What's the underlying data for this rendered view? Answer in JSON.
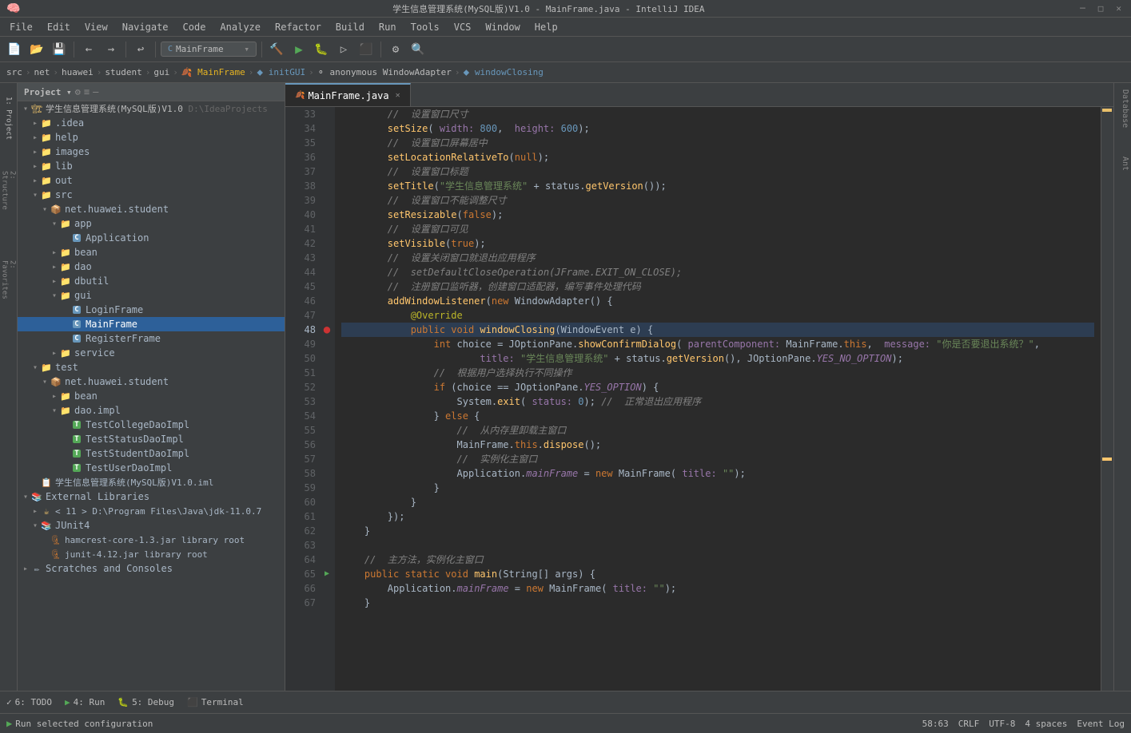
{
  "titleBar": {
    "title": "学生信息管理系统(MySQL版)V1.0 - MainFrame.java - IntelliJ IDEA",
    "controls": [
      "minimize",
      "maximize",
      "close"
    ]
  },
  "menuBar": {
    "items": [
      "File",
      "Edit",
      "View",
      "Navigate",
      "Code",
      "Analyze",
      "Refactor",
      "Build",
      "Run",
      "Tools",
      "VCS",
      "Window",
      "Help"
    ]
  },
  "toolbar": {
    "configName": "MainFrame",
    "buttons": [
      "back",
      "forward",
      "undo",
      "redo",
      "build",
      "run",
      "debug",
      "run-coverage",
      "stop",
      "settings",
      "search"
    ]
  },
  "breadcrumb": {
    "items": [
      {
        "label": "src",
        "type": "folder"
      },
      {
        "label": "net",
        "type": "folder"
      },
      {
        "label": "huawei",
        "type": "folder"
      },
      {
        "label": "student",
        "type": "folder"
      },
      {
        "label": "gui",
        "type": "folder"
      },
      {
        "label": "MainFrame",
        "type": "java"
      },
      {
        "label": "initGUI",
        "type": "method"
      },
      {
        "label": "anonymous WindowAdapter",
        "type": "anonymous"
      },
      {
        "label": "windowClosing",
        "type": "method"
      }
    ]
  },
  "projectPanel": {
    "title": "Project",
    "rootItems": [
      {
        "label": "学生信息管理系统(MySQL版)V1.0",
        "suffix": "D:\\IdeaProjects",
        "type": "project",
        "expanded": true,
        "children": [
          {
            "label": ".idea",
            "type": "folder",
            "expanded": false
          },
          {
            "label": "help",
            "type": "folder",
            "expanded": false
          },
          {
            "label": "images",
            "type": "folder",
            "expanded": false
          },
          {
            "label": "lib",
            "type": "folder",
            "expanded": false
          },
          {
            "label": "out",
            "type": "folder",
            "expanded": false
          },
          {
            "label": "src",
            "type": "folder",
            "expanded": true,
            "children": [
              {
                "label": "net.huawei.student",
                "type": "package",
                "expanded": true,
                "children": [
                  {
                    "label": "app",
                    "type": "folder",
                    "expanded": true,
                    "children": [
                      {
                        "label": "Application",
                        "type": "class",
                        "expanded": false
                      }
                    ]
                  },
                  {
                    "label": "bean",
                    "type": "folder",
                    "expanded": false
                  },
                  {
                    "label": "dao",
                    "type": "folder",
                    "expanded": false
                  },
                  {
                    "label": "dbutil",
                    "type": "folder",
                    "expanded": false
                  },
                  {
                    "label": "gui",
                    "type": "folder",
                    "expanded": true,
                    "children": [
                      {
                        "label": "LoginFrame",
                        "type": "class"
                      },
                      {
                        "label": "MainFrame",
                        "type": "class",
                        "selected": true
                      },
                      {
                        "label": "RegisterFrame",
                        "type": "class"
                      }
                    ]
                  },
                  {
                    "label": "service",
                    "type": "folder",
                    "expanded": false
                  }
                ]
              }
            ]
          },
          {
            "label": "test",
            "type": "folder",
            "expanded": true,
            "children": [
              {
                "label": "net.huawei.student",
                "type": "package",
                "expanded": true,
                "children": [
                  {
                    "label": "bean",
                    "type": "folder",
                    "expanded": false
                  },
                  {
                    "label": "dao.impl",
                    "type": "folder",
                    "expanded": true,
                    "children": [
                      {
                        "label": "TestCollegeDaoImpl",
                        "type": "class"
                      },
                      {
                        "label": "TestStatusDaoImpl",
                        "type": "class"
                      },
                      {
                        "label": "TestStudentDaoImpl",
                        "type": "class"
                      },
                      {
                        "label": "TestUserDaoImpl",
                        "type": "class"
                      }
                    ]
                  }
                ]
              }
            ]
          },
          {
            "label": "学生信息管理系统(MySQL版)V1.0.iml",
            "type": "iml"
          }
        ]
      },
      {
        "label": "External Libraries",
        "type": "libraries",
        "expanded": true,
        "children": [
          {
            "label": "< 11 > D:\\Program Files\\Java\\jdk-11.0.7",
            "type": "jdk",
            "expanded": false
          },
          {
            "label": "JUnit4",
            "type": "library",
            "expanded": true,
            "children": [
              {
                "label": "hamcrest-core-1.3.jar library root",
                "type": "jar"
              },
              {
                "label": "junit-4.12.jar library root",
                "type": "jar"
              }
            ]
          }
        ]
      },
      {
        "label": "Scratches and Consoles",
        "type": "scratches",
        "expanded": false
      }
    ]
  },
  "editor": {
    "filename": "MainFrame.java",
    "startLine": 33,
    "lines": [
      {
        "n": 33,
        "content": "        //  设置窗口尺寸",
        "type": "comment"
      },
      {
        "n": 34,
        "content": "        setSize( width: 800,  height: 600);",
        "type": "code"
      },
      {
        "n": 35,
        "content": "        //  设置窗口屏幕居中",
        "type": "comment"
      },
      {
        "n": 36,
        "content": "        setLocationRelativeTo(null);",
        "type": "code"
      },
      {
        "n": 37,
        "content": "        //  设置窗口标题",
        "type": "comment"
      },
      {
        "n": 38,
        "content": "        setTitle(\"学生信息管理系统\" + status.getVersion());",
        "type": "code"
      },
      {
        "n": 39,
        "content": "        //  设置窗口不能调整尺寸",
        "type": "comment"
      },
      {
        "n": 40,
        "content": "        setResizable(false);",
        "type": "code"
      },
      {
        "n": 41,
        "content": "        //  设置窗口可见",
        "type": "comment"
      },
      {
        "n": 42,
        "content": "        setVisible(true);",
        "type": "code"
      },
      {
        "n": 43,
        "content": "        //  设置关闭窗口就退出应用程序",
        "type": "comment"
      },
      {
        "n": 44,
        "content": "        //  setDefaultCloseOperation(JFrame.EXIT_ON_CLOSE);",
        "type": "comment"
      },
      {
        "n": 45,
        "content": "        //  注册窗口监听器，创建窗口适配器，编写事件处理代码",
        "type": "comment"
      },
      {
        "n": 46,
        "content": "        addWindowListener(new WindowAdapter() {",
        "type": "code"
      },
      {
        "n": 47,
        "content": "            @Override",
        "type": "annotation"
      },
      {
        "n": 48,
        "content": "            public void windowClosing(WindowEvent e) {",
        "type": "code",
        "highlight": true
      },
      {
        "n": 49,
        "content": "                int choice = JOptionPane.showConfirmDialog( parentComponent: MainFrame.this,  message: \"你是否要退出系统？\",",
        "type": "code"
      },
      {
        "n": 50,
        "content": "                        title: \"学生信息管理系统\" + status.getVersion(), JOptionPane.YES_NO_OPTION);",
        "type": "code"
      },
      {
        "n": 51,
        "content": "                //  根据用户选择执行不同操作",
        "type": "comment"
      },
      {
        "n": 52,
        "content": "                if (choice == JOptionPane.YES_OPTION) {",
        "type": "code"
      },
      {
        "n": 53,
        "content": "                    System.exit( status: 0); //  正常退出应用程序",
        "type": "code"
      },
      {
        "n": 54,
        "content": "                } else {",
        "type": "code"
      },
      {
        "n": 55,
        "content": "                    //  从内存里卸载主窗口",
        "type": "comment"
      },
      {
        "n": 56,
        "content": "                    MainFrame.this.dispose();",
        "type": "code"
      },
      {
        "n": 57,
        "content": "                    //  实例化主窗口",
        "type": "comment"
      },
      {
        "n": 58,
        "content": "                    Application.mainFrame = new MainFrame( title: \"\");",
        "type": "code"
      },
      {
        "n": 59,
        "content": "                }",
        "type": "code"
      },
      {
        "n": 60,
        "content": "            }",
        "type": "code"
      },
      {
        "n": 61,
        "content": "        });",
        "type": "code"
      },
      {
        "n": 62,
        "content": "    }",
        "type": "code"
      },
      {
        "n": 63,
        "content": "",
        "type": "empty"
      },
      {
        "n": 64,
        "content": "    //  主方法，实例化主窗口",
        "type": "comment"
      },
      {
        "n": 65,
        "content": "    public static void main(String[] args) {",
        "type": "code"
      },
      {
        "n": 66,
        "content": "        Application.mainFrame = new MainFrame( title: \"\");",
        "type": "code"
      },
      {
        "n": 67,
        "content": "    }",
        "type": "code"
      }
    ]
  },
  "bottomTabs": [
    {
      "label": "6: TODO",
      "icon": "✓"
    },
    {
      "label": "4: Run",
      "icon": "▶"
    },
    {
      "label": "5: Debug",
      "icon": "🐛"
    },
    {
      "label": "Terminal",
      "icon": "⬛"
    }
  ],
  "statusBar": {
    "runStatus": "Run selected configuration",
    "position": "58:63",
    "lineEnding": "CRLF",
    "encoding": "UTF-8",
    "indentation": "4 spaces",
    "notifications": "Event Log"
  },
  "rightSidebar": {
    "labels": [
      "Database",
      "Ant"
    ]
  }
}
